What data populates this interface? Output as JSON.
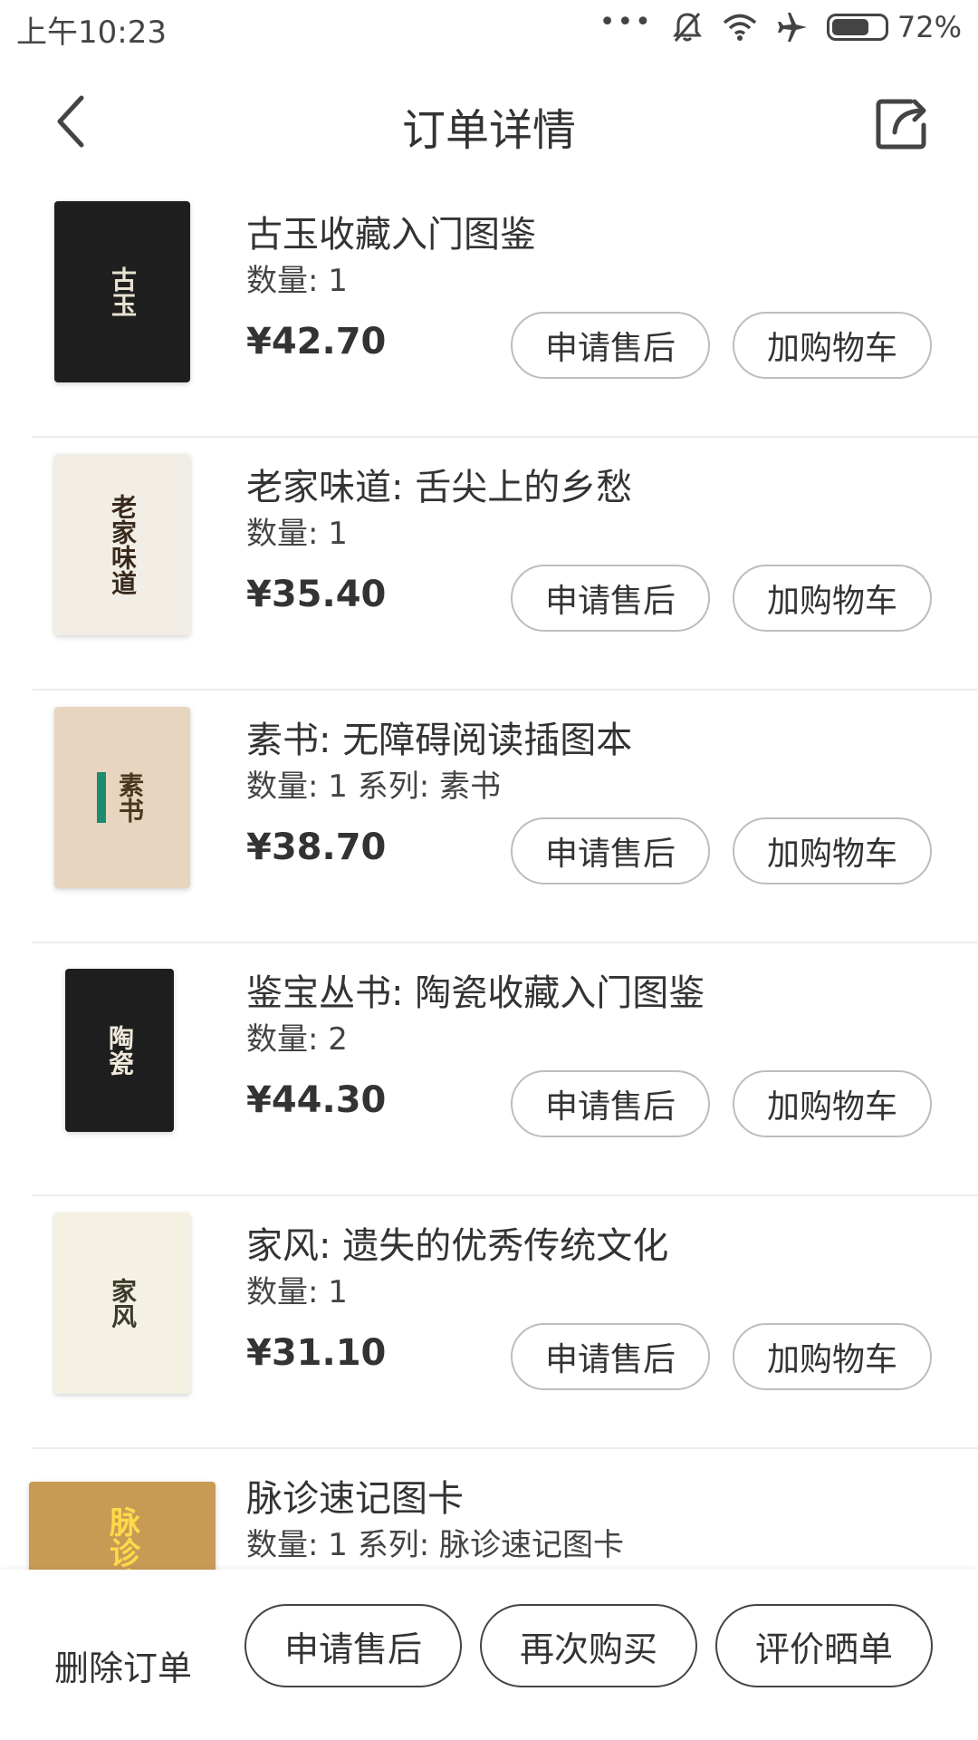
{
  "status_bar": {
    "time": "上午10:23",
    "dots": "•••",
    "battery_percent_text": "72%",
    "battery_level": 0.72,
    "icons": [
      "more-dots-icon",
      "mute-bell-icon",
      "wifi-icon",
      "airplane-icon",
      "battery-icon"
    ]
  },
  "header": {
    "title": "订单详情",
    "back_icon": "chevron-left-icon",
    "share_icon": "share-icon"
  },
  "items": [
    {
      "title": "古玉收藏入门图鉴",
      "meta": "数量: 1",
      "price": "¥42.70",
      "cover_title": "古玉",
      "cover_colors": {
        "bg": "#1f1f1f",
        "fg": "#e8e2d2",
        "accent": "#a7c0a3"
      },
      "aftersale_label": "申请售后",
      "addcart_label": "加购物车"
    },
    {
      "title": "老家味道: 舌尖上的乡愁",
      "meta": "数量: 1",
      "price": "¥35.40",
      "cover_title": "老家味道",
      "cover_colors": {
        "bg": "#f2eee6",
        "fg": "#3a2a1c",
        "accent": "#8a5a3c"
      },
      "aftersale_label": "申请售后",
      "addcart_label": "加购物车"
    },
    {
      "title": "素书: 无障碍阅读插图本",
      "meta": "数量: 1 系列: 素书",
      "price": "¥38.70",
      "cover_title": "素书",
      "cover_colors": {
        "bg": "#e7d5bf",
        "fg": "#4a3720",
        "accent": "#1e8b6f"
      },
      "aftersale_label": "申请售后",
      "addcart_label": "加购物车"
    },
    {
      "title": "鉴宝丛书: 陶瓷收藏入门图鉴",
      "meta": "数量: 2",
      "price": "¥44.30",
      "cover_title": "陶瓷",
      "cover_colors": {
        "bg": "#1e1e1e",
        "fg": "#efe9da",
        "accent": "#b23a2a"
      },
      "aftersale_label": "申请售后",
      "addcart_label": "加购物车"
    },
    {
      "title": "家风: 遗失的优秀传统文化",
      "meta": "数量: 1",
      "price": "¥31.10",
      "cover_title": "家风",
      "cover_colors": {
        "bg": "#f4f1e3",
        "fg": "#3b3b2a",
        "accent": "#9db383"
      },
      "aftersale_label": "申请售后",
      "addcart_label": "加购物车"
    },
    {
      "title": "脉诊速记图卡",
      "meta": "数量: 1 系列: 脉诊速记图卡",
      "cover_title": "脉诊速记",
      "cover_colors": {
        "bg": "#c89b54",
        "fg": "#ffd94a",
        "accent": "#d62e2e"
      }
    }
  ],
  "bottom_bar": {
    "delete_label": "删除订单",
    "aftersale_label": "申请售后",
    "rebuy_label": "再次购买",
    "review_label": "评价晒单"
  }
}
